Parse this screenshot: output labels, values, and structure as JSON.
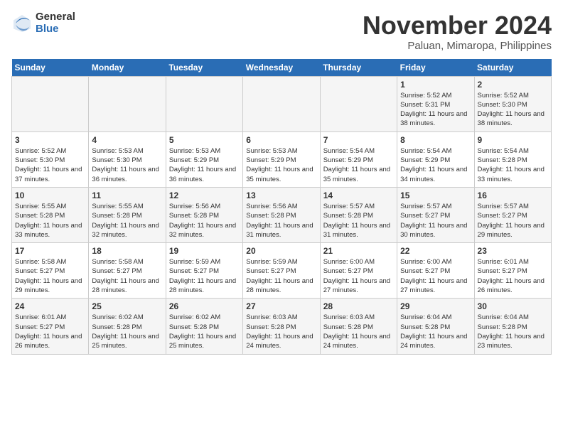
{
  "header": {
    "logo_general": "General",
    "logo_blue": "Blue",
    "month_title": "November 2024",
    "location": "Paluan, Mimaropa, Philippines"
  },
  "weekdays": [
    "Sunday",
    "Monday",
    "Tuesday",
    "Wednesday",
    "Thursday",
    "Friday",
    "Saturday"
  ],
  "rows": [
    [
      {
        "day": "",
        "info": ""
      },
      {
        "day": "",
        "info": ""
      },
      {
        "day": "",
        "info": ""
      },
      {
        "day": "",
        "info": ""
      },
      {
        "day": "",
        "info": ""
      },
      {
        "day": "1",
        "info": "Sunrise: 5:52 AM\nSunset: 5:31 PM\nDaylight: 11 hours and 38 minutes."
      },
      {
        "day": "2",
        "info": "Sunrise: 5:52 AM\nSunset: 5:30 PM\nDaylight: 11 hours and 38 minutes."
      }
    ],
    [
      {
        "day": "3",
        "info": "Sunrise: 5:52 AM\nSunset: 5:30 PM\nDaylight: 11 hours and 37 minutes."
      },
      {
        "day": "4",
        "info": "Sunrise: 5:53 AM\nSunset: 5:30 PM\nDaylight: 11 hours and 36 minutes."
      },
      {
        "day": "5",
        "info": "Sunrise: 5:53 AM\nSunset: 5:29 PM\nDaylight: 11 hours and 36 minutes."
      },
      {
        "day": "6",
        "info": "Sunrise: 5:53 AM\nSunset: 5:29 PM\nDaylight: 11 hours and 35 minutes."
      },
      {
        "day": "7",
        "info": "Sunrise: 5:54 AM\nSunset: 5:29 PM\nDaylight: 11 hours and 35 minutes."
      },
      {
        "day": "8",
        "info": "Sunrise: 5:54 AM\nSunset: 5:29 PM\nDaylight: 11 hours and 34 minutes."
      },
      {
        "day": "9",
        "info": "Sunrise: 5:54 AM\nSunset: 5:28 PM\nDaylight: 11 hours and 33 minutes."
      }
    ],
    [
      {
        "day": "10",
        "info": "Sunrise: 5:55 AM\nSunset: 5:28 PM\nDaylight: 11 hours and 33 minutes."
      },
      {
        "day": "11",
        "info": "Sunrise: 5:55 AM\nSunset: 5:28 PM\nDaylight: 11 hours and 32 minutes."
      },
      {
        "day": "12",
        "info": "Sunrise: 5:56 AM\nSunset: 5:28 PM\nDaylight: 11 hours and 32 minutes."
      },
      {
        "day": "13",
        "info": "Sunrise: 5:56 AM\nSunset: 5:28 PM\nDaylight: 11 hours and 31 minutes."
      },
      {
        "day": "14",
        "info": "Sunrise: 5:57 AM\nSunset: 5:28 PM\nDaylight: 11 hours and 31 minutes."
      },
      {
        "day": "15",
        "info": "Sunrise: 5:57 AM\nSunset: 5:27 PM\nDaylight: 11 hours and 30 minutes."
      },
      {
        "day": "16",
        "info": "Sunrise: 5:57 AM\nSunset: 5:27 PM\nDaylight: 11 hours and 29 minutes."
      }
    ],
    [
      {
        "day": "17",
        "info": "Sunrise: 5:58 AM\nSunset: 5:27 PM\nDaylight: 11 hours and 29 minutes."
      },
      {
        "day": "18",
        "info": "Sunrise: 5:58 AM\nSunset: 5:27 PM\nDaylight: 11 hours and 28 minutes."
      },
      {
        "day": "19",
        "info": "Sunrise: 5:59 AM\nSunset: 5:27 PM\nDaylight: 11 hours and 28 minutes."
      },
      {
        "day": "20",
        "info": "Sunrise: 5:59 AM\nSunset: 5:27 PM\nDaylight: 11 hours and 28 minutes."
      },
      {
        "day": "21",
        "info": "Sunrise: 6:00 AM\nSunset: 5:27 PM\nDaylight: 11 hours and 27 minutes."
      },
      {
        "day": "22",
        "info": "Sunrise: 6:00 AM\nSunset: 5:27 PM\nDaylight: 11 hours and 27 minutes."
      },
      {
        "day": "23",
        "info": "Sunrise: 6:01 AM\nSunset: 5:27 PM\nDaylight: 11 hours and 26 minutes."
      }
    ],
    [
      {
        "day": "24",
        "info": "Sunrise: 6:01 AM\nSunset: 5:27 PM\nDaylight: 11 hours and 26 minutes."
      },
      {
        "day": "25",
        "info": "Sunrise: 6:02 AM\nSunset: 5:28 PM\nDaylight: 11 hours and 25 minutes."
      },
      {
        "day": "26",
        "info": "Sunrise: 6:02 AM\nSunset: 5:28 PM\nDaylight: 11 hours and 25 minutes."
      },
      {
        "day": "27",
        "info": "Sunrise: 6:03 AM\nSunset: 5:28 PM\nDaylight: 11 hours and 24 minutes."
      },
      {
        "day": "28",
        "info": "Sunrise: 6:03 AM\nSunset: 5:28 PM\nDaylight: 11 hours and 24 minutes."
      },
      {
        "day": "29",
        "info": "Sunrise: 6:04 AM\nSunset: 5:28 PM\nDaylight: 11 hours and 24 minutes."
      },
      {
        "day": "30",
        "info": "Sunrise: 6:04 AM\nSunset: 5:28 PM\nDaylight: 11 hours and 23 minutes."
      }
    ]
  ]
}
